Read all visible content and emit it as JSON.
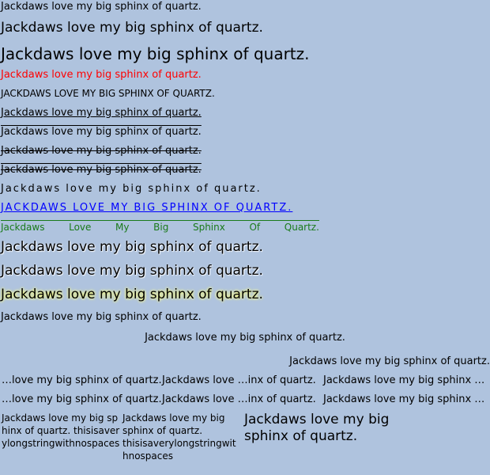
{
  "lines": {
    "l1": "Jackdaws love my big sphinx of quartz.",
    "l2": "Jackdaws love my big sphinx of quartz.",
    "l3": "Jackdaws love my big sphinx of quartz.",
    "l4_red": "Jackdaws love my big sphinx of quartz.",
    "l5_upper": "JACKDAWS LOVE MY BIG SPHINX OF QUARTZ.",
    "l6_underline": "Jackdaws love my big sphinx of quartz.",
    "l7_overline": "Jackdaws love my big sphinx of quartz.",
    "l8_strike": "Jackdaws love my big sphinx of quartz.",
    "l9_strike_over": "Jackdaws love my big sphinx of quartz.",
    "l10_spaced": "Jackdaws love my big sphinx of quartz.",
    "l11_blue": "JACKDAWS LOVE MY BIG SPHINX OF QUARTZ.",
    "l13_shadow": "Jackdaws love my big sphinx of quartz.",
    "l14_shadow": "Jackdaws love my big sphinx of quartz.",
    "l15_glow": "Jackdaws love my big sphinx of quartz.",
    "l16": "Jackdaws love my big sphinx of quartz.",
    "l17_center": "Jackdaws love my big sphinx of quartz.",
    "l18_right": "Jackdaws love my big sphinx of quartz."
  },
  "green_words": [
    "Jackdaws",
    "Love",
    "My",
    "Big",
    "Sphinx",
    "Of",
    "Quartz."
  ],
  "ellipsis_rows": [
    {
      "a": "…love my big sphinx of quartz.",
      "b": "Jackdaws love …inx of quartz.",
      "c": "Jackdaws love my big sphinx …"
    },
    {
      "a": "…love my big sphinx of quartz.",
      "b": "Jackdaws love …inx of quartz.",
      "c": "Jackdaws love my big sphinx …"
    }
  ],
  "wrap": {
    "box1": "Jackdaws love my big sphinx of quartz. thisisaverylongstringwithnospaces",
    "box2": "Jackdaws love my big sphinx of quartz. thisisaverylongstringwithnospaces",
    "box3": "Jackdaws love my big sphinx of quartz."
  },
  "colors": {
    "background": "#afc3de",
    "red": "#ff0000",
    "blue": "#0000ff",
    "green": "#1a7a1a"
  }
}
